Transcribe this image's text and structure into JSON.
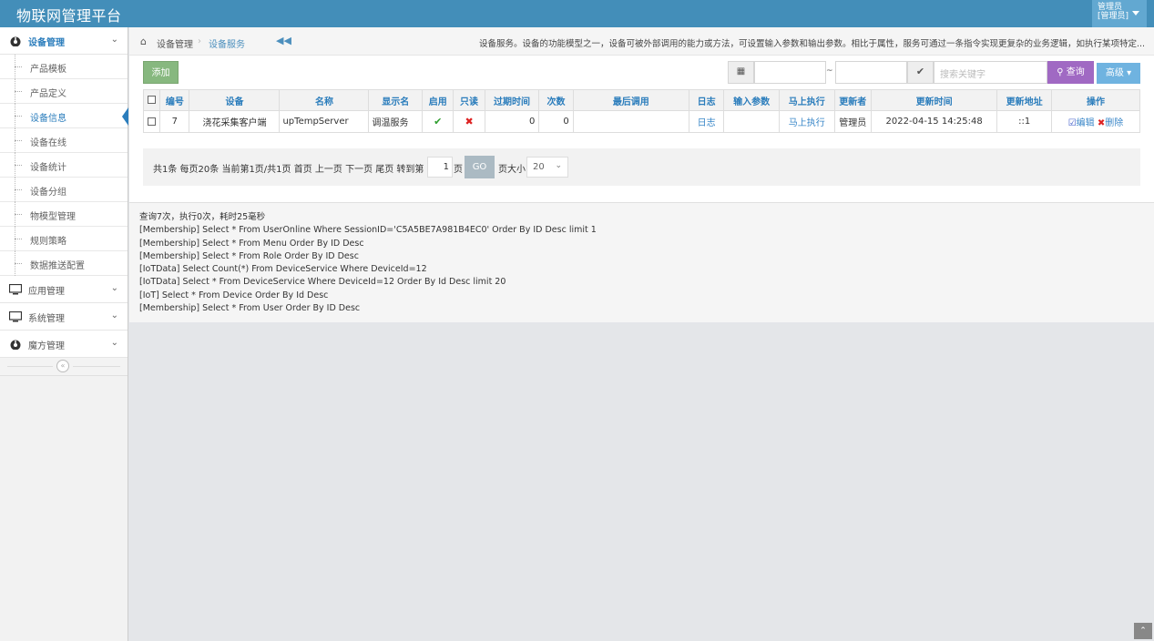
{
  "app": {
    "title": "物联网管理平台"
  },
  "user": {
    "name": "管理员",
    "role": "[管理员]"
  },
  "sidebar": {
    "groups": [
      {
        "label": "设备管理",
        "icon": "dashboard-icon",
        "expanded": true
      },
      {
        "label": "应用管理",
        "icon": "desktop-icon"
      },
      {
        "label": "系统管理",
        "icon": "desktop-icon"
      },
      {
        "label": "魔方管理",
        "icon": "dashboard-icon"
      }
    ],
    "subitems": [
      "产品模板",
      "产品定义",
      "设备信息",
      "设备在线",
      "设备统计",
      "设备分组",
      "物模型管理",
      "规则策略",
      "数据推送配置"
    ],
    "active_subitem": "设备信息",
    "collapse_symbol": "«"
  },
  "breadcrumb": {
    "parent": "设备管理",
    "current": "设备服务",
    "separator": "›"
  },
  "description": "设备服务。设备的功能模型之一，设备可被外部调用的能力或方法，可设置输入参数和输出参数。相比于属性，服务可通过一条指令实现更复杂的业务逻辑，如执行某项特定...",
  "toolbar": {
    "add_label": "添加",
    "date_separator": "~",
    "search_placeholder": "搜索关键字",
    "query_label": "查询",
    "advanced_label": "高级"
  },
  "table": {
    "headers": [
      "编号",
      "设备",
      "名称",
      "显示名",
      "启用",
      "只读",
      "过期时间",
      "次数",
      "最后调用",
      "日志",
      "输入参数",
      "马上执行",
      "更新者",
      "更新时间",
      "更新地址",
      "操作"
    ],
    "rows": [
      {
        "id": "7",
        "device": "浇花采集客户端",
        "name": "upTempServer",
        "display_name": "调温服务",
        "enabled": true,
        "readonly": false,
        "expire": "0",
        "count": "0",
        "last_call": "",
        "log": "日志",
        "input_params": "",
        "execute": "马上执行",
        "updater": "管理员",
        "update_time": "2022-04-15 14:25:48",
        "update_ip": "::1",
        "edit": "编辑",
        "delete": "删除"
      }
    ]
  },
  "pager": {
    "summary": "共1条 每页20条 当前第1页/共1页 首页 上一页 下一页 尾页 转到第",
    "page_value": "1",
    "page_unit": "页",
    "go_label": "GO",
    "size_label": "页大小",
    "size_value": "20"
  },
  "log": {
    "lines": [
      "查询7次，执行0次，耗时25毫秒",
      "[Membership] Select * From UserOnline Where SessionID='C5A5BE7A981B4EC0' Order By ID Desc limit 1",
      "[Membership] Select * From Menu Order By ID Desc",
      "[Membership] Select * From Role Order By ID Desc",
      "[IoTData] Select Count(*) From DeviceService Where DeviceId=12",
      "[IoTData] Select * From DeviceService Where DeviceId=12 Order By Id Desc limit 20",
      "[IoT] Select * From Device Order By Id Desc",
      "[Membership] Select * From User Order By ID Desc"
    ]
  },
  "colors": {
    "navbar": "#438eb9",
    "accent": "#2b7dbc",
    "add": "#87b87f",
    "query": "#a069c3",
    "advanced": "#6fb3e0"
  }
}
